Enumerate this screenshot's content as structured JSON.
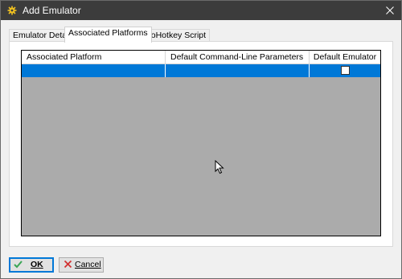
{
  "window": {
    "title": "Add Emulator",
    "icon": "gear-icon",
    "close_icon": "close-icon"
  },
  "tabs": [
    {
      "label": "Emulator Details",
      "active": false
    },
    {
      "label": "Associated Platforms",
      "active": true
    },
    {
      "label": "AutoHotkey Script",
      "active": false
    }
  ],
  "grid": {
    "columns": [
      "Associated Platform",
      "Default Command-Line Parameters",
      "Default Emulator"
    ],
    "rows": [
      {
        "platform": "",
        "parameters": "",
        "default_emulator": false,
        "selected": true
      }
    ]
  },
  "buttons": {
    "ok": {
      "label": "OK",
      "icon": "checkmark-icon"
    },
    "cancel": {
      "label": "Cancel",
      "icon": "x-icon"
    }
  },
  "colors": {
    "titlebar": "#3c3c3c",
    "selection": "#0078d7",
    "grid_background": "#ababab",
    "ok_check": "#3aa655",
    "cancel_x": "#d23030"
  }
}
